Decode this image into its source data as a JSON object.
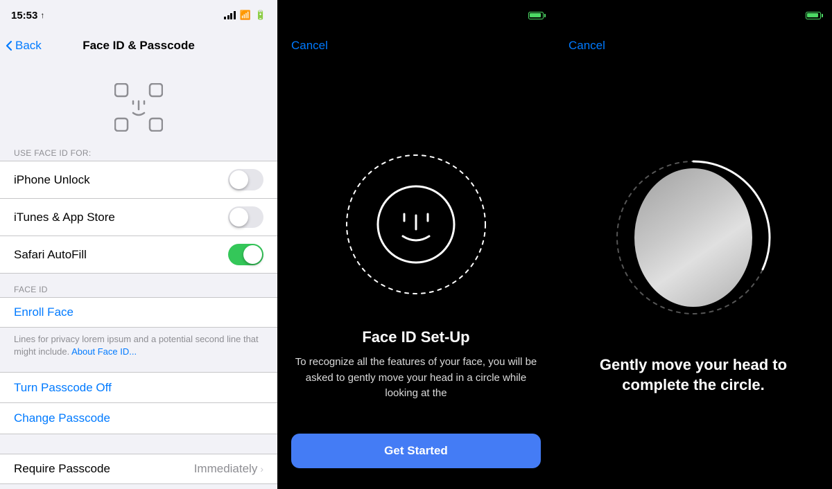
{
  "panel1": {
    "statusbar": {
      "time": "15:53",
      "direction_icon": "↑"
    },
    "navbar": {
      "back_label": "Back",
      "title": "Face ID & Passcode"
    },
    "use_face_id_section_label": "USE FACE ID FOR:",
    "toggles": [
      {
        "label": "iPhone Unlock",
        "state": "off"
      },
      {
        "label": "iTunes & App Store",
        "state": "off"
      },
      {
        "label": "Safari AutoFill",
        "state": "on"
      }
    ],
    "face_id_section_label": "FACE ID",
    "enroll_face_label": "Enroll Face",
    "description_text": "Lines for privacy lorem ipsum and a potential second line that might include.",
    "about_link_text": "About Face ID...",
    "turn_passcode_off_label": "Turn Passcode Off",
    "change_passcode_label": "Change Passcode",
    "require_passcode_label": "Require Passcode",
    "require_passcode_value": "Immediately"
  },
  "panel2": {
    "cancel_label": "Cancel",
    "title": "Face ID Set-Up",
    "description": "To recognize all the features of your face, you will be asked to gently move your head in a circle while looking at the",
    "get_started_label": "Get Started"
  },
  "panel3": {
    "cancel_label": "Cancel",
    "instruction_text": "Gently move your head to complete the circle."
  }
}
